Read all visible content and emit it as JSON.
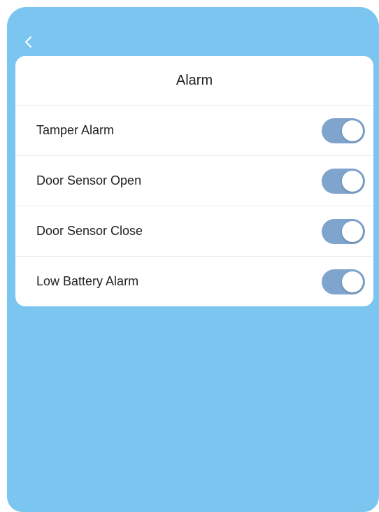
{
  "colors": {
    "background": "#7ac6f0",
    "card": "#ffffff",
    "toggle_on": "#7fa5cf"
  },
  "nav": {
    "back_icon": "chevron-left-icon"
  },
  "card": {
    "title": "Alarm",
    "items": [
      {
        "label": "Tamper Alarm",
        "enabled": true
      },
      {
        "label": "Door Sensor Open",
        "enabled": true
      },
      {
        "label": "Door Sensor Close",
        "enabled": true
      },
      {
        "label": "Low Battery Alarm",
        "enabled": true
      }
    ]
  }
}
